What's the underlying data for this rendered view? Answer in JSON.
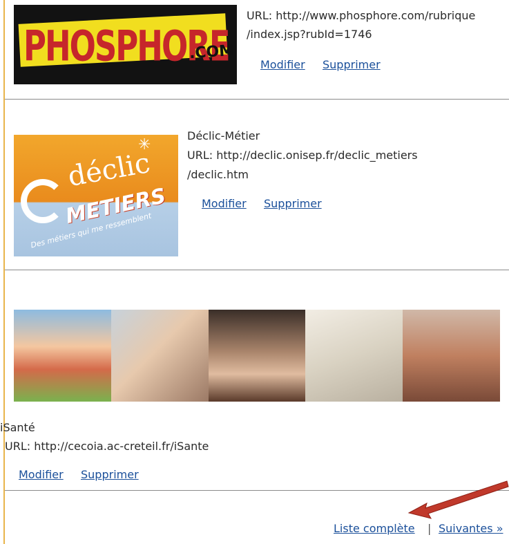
{
  "entries": [
    {
      "logo_text": "PHOSPHORE",
      "logo_suffix": ".COM",
      "url_line1": "URL: http://www.phosphore.com/rubrique",
      "url_line2": "/index.jsp?rubId=1746",
      "modify": "Modifier",
      "delete": "Supprimer"
    },
    {
      "title": "Déclic-Métier",
      "url_line1": "URL: http://declic.onisep.fr/declic_metiers",
      "url_line2": "/declic.htm",
      "logo_text": "déclic",
      "logo_sub": "METIERS",
      "logo_tagline": "Des métiers qui me ressemblent",
      "modify": "Modifier",
      "delete": "Supprimer"
    },
    {
      "title": "iSanté",
      "url_line1": "URL: http://cecoia.ac-creteil.fr/iSante",
      "modify": "Modifier",
      "delete": "Supprimer"
    }
  ],
  "footer": {
    "full_list": "Liste complète",
    "separator": "|",
    "next": "Suivantes »"
  },
  "colors": {
    "link": "#1a4f9a",
    "arrow": "#c0392b"
  }
}
